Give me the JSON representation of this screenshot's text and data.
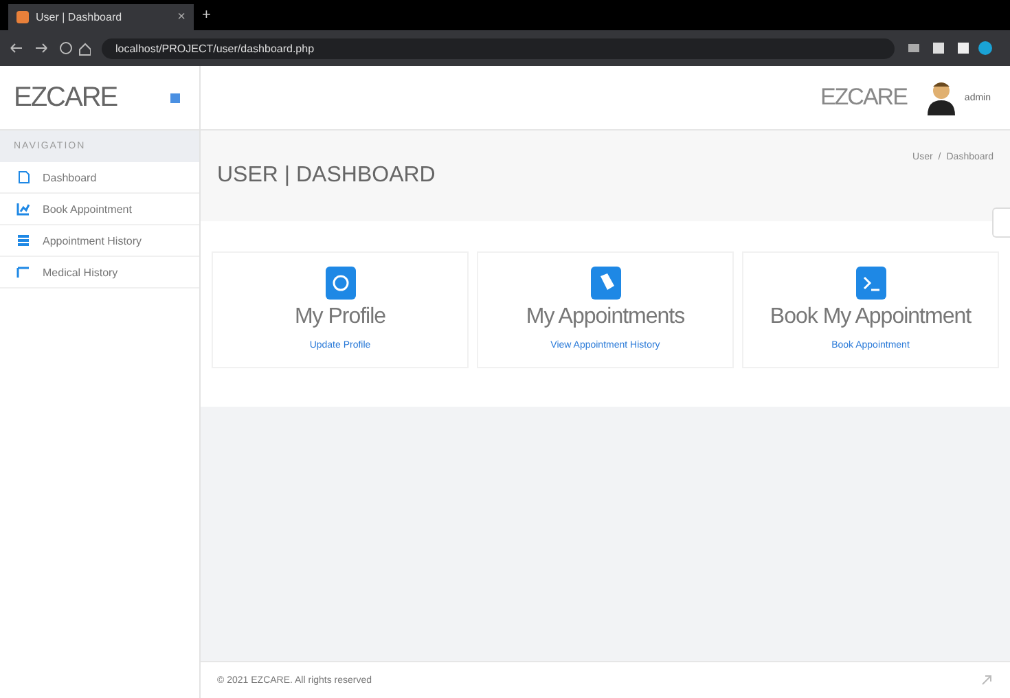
{
  "browser": {
    "tab_title": "User | Dashboard",
    "tab_close": "×",
    "new_tab": "+",
    "url": "localhost/PROJECT/user/dashboard.php"
  },
  "sidebar": {
    "logo": "EZCARE",
    "section": "NAVIGATION",
    "items": [
      {
        "label": "Dashboard",
        "selected": false
      },
      {
        "label": "Book Appointment",
        "selected": false
      },
      {
        "label": "Appointment History",
        "selected": false
      },
      {
        "label": "Medical History",
        "selected": false
      }
    ]
  },
  "header": {
    "brand": "EZCARE",
    "user": "admin"
  },
  "page": {
    "title": "USER | DASHBOARD",
    "breadcrumb": [
      "User",
      "/",
      "Dashboard"
    ]
  },
  "cards": [
    {
      "title": "My Profile",
      "link": "Update Profile"
    },
    {
      "title": "My Appointments",
      "link": "View Appointment History"
    },
    {
      "title": "Book My Appointment",
      "link": "Book Appointment"
    }
  ],
  "footer": {
    "text": "© 2021 EZCARE. All rights reserved"
  }
}
